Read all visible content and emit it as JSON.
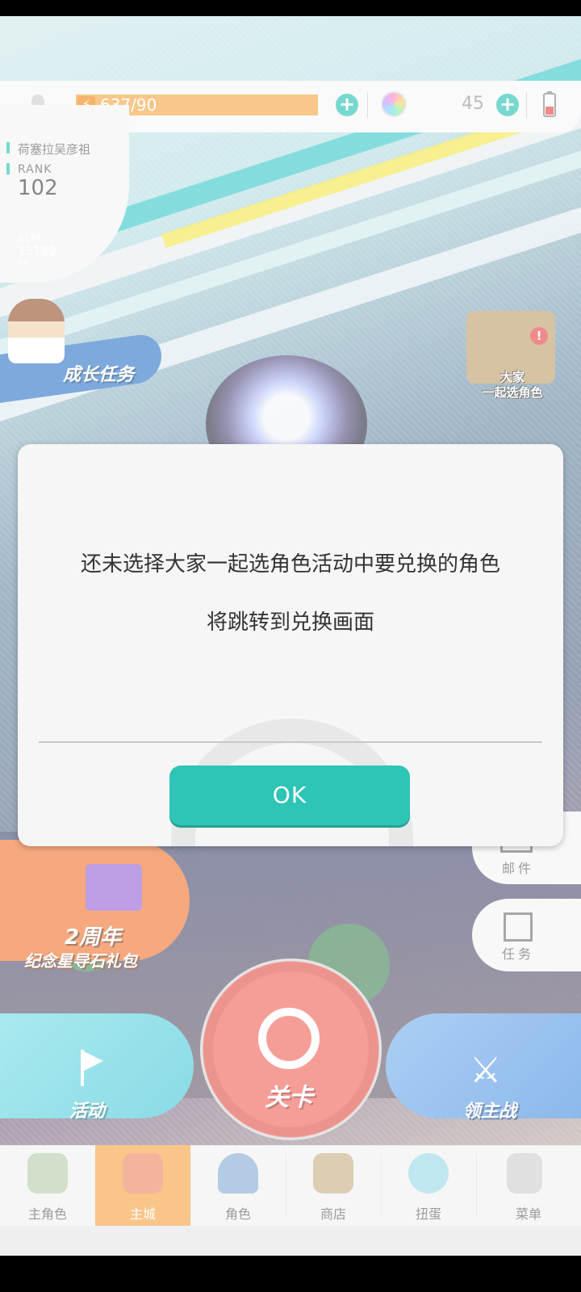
{
  "header": {
    "stamina": "637/90",
    "gem_count": "45"
  },
  "profile": {
    "player_name": "荷塞拉吴彦祖",
    "rank_label": "RANK",
    "rank_value": "102",
    "next_label": "NEXT",
    "next_value": "13189",
    "rp_label": "RP"
  },
  "banners": {
    "growth_task": "成长任务",
    "event_pick": "大家\n一起选角色",
    "gift_title": "2周年",
    "gift_subtitle": "纪念星导石礼包"
  },
  "side_buttons": {
    "mail": "邮件",
    "task": "任务"
  },
  "main_buttons": {
    "event": "活动",
    "stage": "关卡",
    "boss": "领主战"
  },
  "nav": {
    "items": [
      {
        "label": "主角色"
      },
      {
        "label": "主城"
      },
      {
        "label": "角色"
      },
      {
        "label": "商店"
      },
      {
        "label": "扭蛋"
      },
      {
        "label": "菜单"
      }
    ],
    "active_index": 1
  },
  "dialog": {
    "message_line1": "还未选择大家一起选角色活动中要兑换的角色",
    "message_line2": "将跳转到兑换画面",
    "ok_label": "OK"
  },
  "colors": {
    "accent": "#2ec4b6",
    "stamina": "#f5a94a",
    "nav_active": "#f6a64b",
    "stage_button": "#f06b62"
  }
}
